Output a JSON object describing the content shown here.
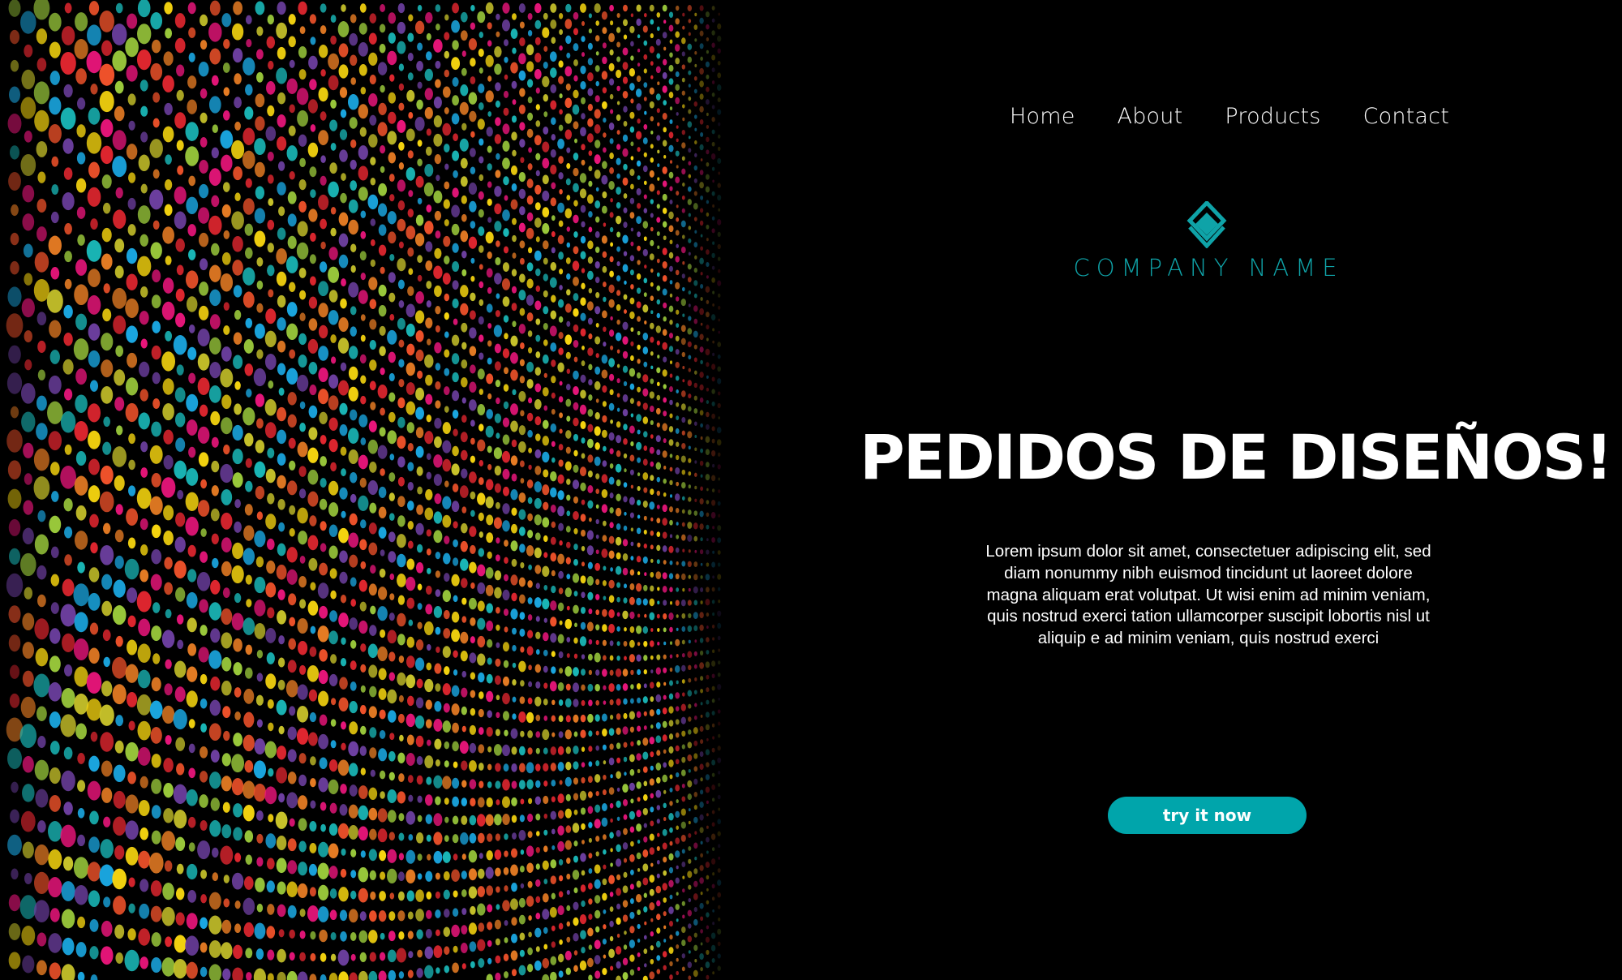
{
  "nav": {
    "items": [
      {
        "label": "Home"
      },
      {
        "label": "About"
      },
      {
        "label": "Products"
      },
      {
        "label": "Contact"
      }
    ]
  },
  "brand": {
    "logo_icon": "diamond-logo-icon",
    "company_name": "COMPANY NAME",
    "accent_color": "#0fa3a8"
  },
  "hero": {
    "headline": "PEDIDOS DE DISEÑOS!",
    "body": "Lorem ipsum dolor sit amet, consectetuer adipiscing elit, sed diam nonummy nibh euismod tincidunt ut laoreet dolore magna aliquam erat volutpat. Ut wisi enim ad minim veniam, quis nostrud exerci tation ullamcorper suscipit lobortis nisl ut aliquip e ad minim veniam, quis nostrud exerci",
    "cta_label": "try it now",
    "cta_color": "#00a5ab"
  },
  "decor": {
    "dot_palette": [
      "#e8157a",
      "#f5d40f",
      "#1aa6e0",
      "#6d3fa0",
      "#f0522a",
      "#9ac93b",
      "#19b5b5",
      "#e0262f",
      "#c7c22a",
      "#e57b23"
    ],
    "background_color": "#000000"
  }
}
